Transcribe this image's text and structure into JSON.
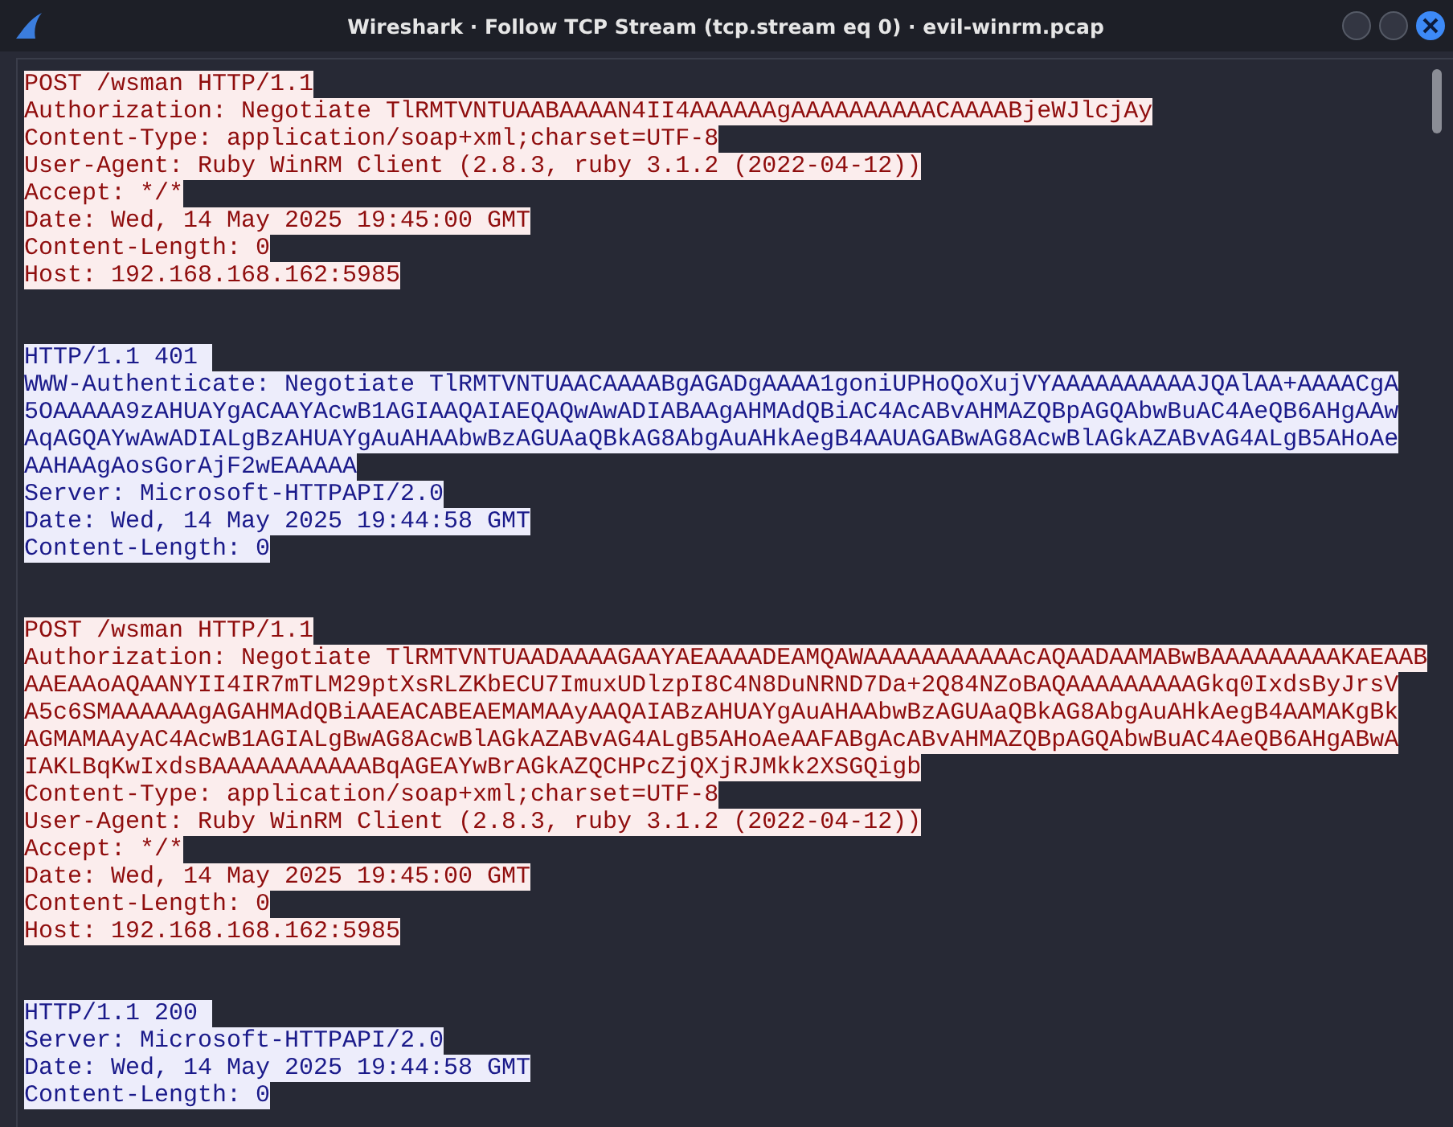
{
  "window": {
    "title": "Wireshark · Follow TCP Stream (tcp.stream eq 0) · evil-winrm.pcap"
  },
  "stream": [
    {
      "kind": "client",
      "lines": [
        "POST /wsman HTTP/1.1",
        "Authorization: Negotiate TlRMTVNTUAABAAAAN4II4AAAAAAgAAAAAAAAAACAAAABjeWJlcjAy",
        "Content-Type: application/soap+xml;charset=UTF-8",
        "User-Agent: Ruby WinRM Client (2.8.3, ruby 3.1.2 (2022-04-12))",
        "Accept: */*",
        "Date: Wed, 14 May 2025 19:45:00 GMT",
        "Content-Length: 0",
        "Host: 192.168.168.162:5985"
      ]
    },
    {
      "kind": "server",
      "lines": [
        "HTTP/1.1 401 ",
        "WWW-Authenticate: Negotiate TlRMTVNTUAACAAAABgAGADgAAAA1goniUPHoQoXujVYAAAAAAAAAAJQAlAA+AAAACgA",
        "5OAAAAA9zAHUAYgACAAYAcwB1AGIAAQAIAEQAQwAwADIABAAgAHMAdQBiAC4AcABvAHMAZQBpAGQAbwBuAC4AeQB6AHgAAw",
        "AqAGQAYwAwADIALgBzAHUAYgAuAHAAbwBzAGUAaQBkAG8AbgAuAHkAegB4AAUAGABwAG8AcwBlAGkAZABvAG4ALgB5AHoAe",
        "AAHAAgAosGorAjF2wEAAAAA",
        "Server: Microsoft-HTTPAPI/2.0",
        "Date: Wed, 14 May 2025 19:44:58 GMT",
        "Content-Length: 0"
      ]
    },
    {
      "kind": "client",
      "lines": [
        "POST /wsman HTTP/1.1",
        "Authorization: Negotiate TlRMTVNTUAADAAAAGAAYAEAAAADEAMQAWAAAAAAAAAAAcAQAADAAMABwBAAAAAAAAAKAEAAB",
        "AAEAAoAQAANYII4IR7mTLM29ptXsRLZKbECU7ImuxUDlzpI8C4N8DuNRND7Da+2Q84NZoBAQAAAAAAAAAGkq0IxdsByJrsV",
        "A5c6SMAAAAAAgAGAHMAdQBiAAEACABEAEMAMAAyAAQAIABzAHUAYgAuAHAAbwBzAGUAaQBkAG8AbgAuAHkAegB4AAMAKgBk",
        "AGMAMAAyAC4AcwB1AGIALgBwAG8AcwBlAGkAZABvAG4ALgB5AHoAeAAFABgAcABvAHMAZQBpAGQAbwBuAC4AeQB6AHgABwA",
        "IAKLBqKwIxdsBAAAAAAAAAAABqAGEAYwBrAGkAZQCHPcZjQXjRJMkk2XSGQigb",
        "Content-Type: application/soap+xml;charset=UTF-8",
        "User-Agent: Ruby WinRM Client (2.8.3, ruby 3.1.2 (2022-04-12))",
        "Accept: */*",
        "Date: Wed, 14 May 2025 19:45:00 GMT",
        "Content-Length: 0",
        "Host: 192.168.168.162:5985"
      ]
    },
    {
      "kind": "server",
      "lines": [
        "HTTP/1.1 200 ",
        "Server: Microsoft-HTTPAPI/2.0",
        "Date: Wed, 14 May 2025 19:44:58 GMT",
        "Content-Length: 0"
      ]
    }
  ]
}
